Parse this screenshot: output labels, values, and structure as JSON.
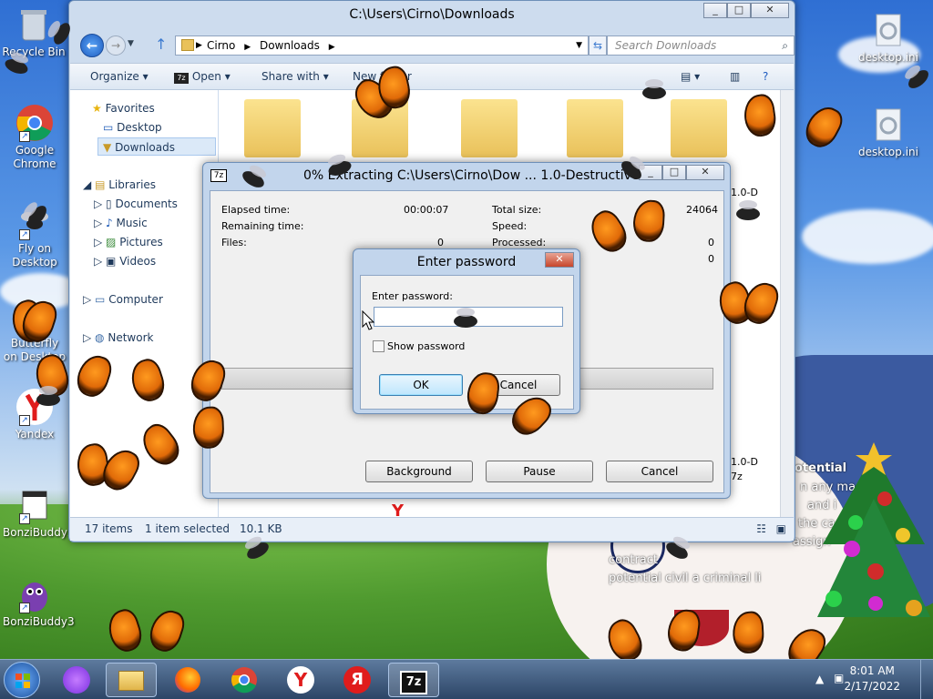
{
  "desktop": {
    "icons": [
      {
        "label": "Recycle Bin",
        "icon": "recycle-bin-icon"
      },
      {
        "label": "Google Chrome",
        "icon": "chrome-icon"
      },
      {
        "label": "Fly on Desktop",
        "icon": "fly-icon"
      },
      {
        "label": "Butterfly on Desktop",
        "icon": "butterfly-icon"
      },
      {
        "label": "Yandex",
        "icon": "yandex-icon"
      },
      {
        "label": "BonziBuddy2",
        "icon": "bonzibuddy-icon"
      },
      {
        "label": "BonziBuddy3",
        "icon": "bonzibuddy-icon"
      },
      {
        "label": "desktop.ini",
        "icon": "settings-file-icon"
      },
      {
        "label": "desktop.ini",
        "icon": "settings-file-icon"
      }
    ],
    "overlay_lines": [
      "otential",
      "n any ma",
      "and i",
      "the ca",
      "assign",
      "contract",
      "potential civil a criminal li"
    ]
  },
  "explorer": {
    "title": "C:\\Users\\Cirno\\Downloads",
    "breadcrumb": [
      "Cirno",
      "Downloads"
    ],
    "search_placeholder": "Search Downloads",
    "toolbar": {
      "organize": "Organize",
      "open": "Open",
      "share": "Share with",
      "newfolder": "New folder"
    },
    "nav": {
      "favorites": "Favorites",
      "desktop": "Desktop",
      "downloads": "Downloads",
      "libraries": "Libraries",
      "documents": "Documents",
      "music": "Music",
      "pictures": "Pictures",
      "videos": "Videos",
      "computer": "Computer",
      "network": "Network"
    },
    "status": {
      "items": "17 items",
      "selected": "1 item selected",
      "size": "10.1 KB"
    },
    "right_snippets": [
      "1.0-D",
      "1.0-D",
      "7z"
    ]
  },
  "extract_dialog": {
    "title": "0% Extracting C:\\Users\\Cirno\\Dow ... 1.0-Destructive.7z",
    "elapsed_label": "Elapsed time:",
    "elapsed_value": "00:00:07",
    "remaining_label": "Remaining time:",
    "files_label": "Files:",
    "files_value": "0",
    "totalsize_label": "Total size:",
    "totalsize_value": "24064",
    "speed_label": "Speed:",
    "processed_label": "Processed:",
    "processed_value": "0",
    "extra_value": "0",
    "progress": 0,
    "buttons": {
      "background": "Background",
      "pause": "Pause",
      "cancel": "Cancel"
    }
  },
  "password_dialog": {
    "title": "Enter password",
    "prompt": "Enter password:",
    "value": "",
    "show_password": "Show password",
    "ok": "OK",
    "cancel": "Cancel"
  },
  "taskbar": {
    "apps": [
      "start",
      "alice",
      "explorer",
      "firefox",
      "chrome",
      "yandex-browser",
      "yandex",
      "7-zip"
    ],
    "time": "8:01 AM",
    "date": "2/17/2022"
  }
}
